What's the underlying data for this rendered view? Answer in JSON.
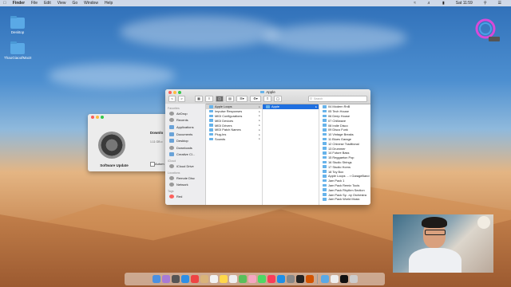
{
  "menubar": {
    "apple": "",
    "items": [
      "Finder",
      "File",
      "Edit",
      "View",
      "Go",
      "Window",
      "Help"
    ],
    "clock": "Sat 11:59"
  },
  "desktop": {
    "icons": [
      {
        "label": "Desktop"
      },
      {
        "label": "ThaoGiaoofMacII"
      }
    ]
  },
  "logo": {
    "text": "LetLogoGo",
    "sub": "GH"
  },
  "software_update": {
    "title": "Software Update",
    "downloading": "Downlo",
    "subline": "1.11 GB o",
    "auto_label": "Autom"
  },
  "finder": {
    "title": "Apple",
    "search_placeholder": "Search",
    "back": "<",
    "forward": ">",
    "sidebar": {
      "favorites_header": "Favorites",
      "favorites": [
        "AirDrop",
        "Recents",
        "Applications",
        "Documents",
        "Desktop",
        "Downloads",
        "Creative Cl..."
      ],
      "icloud_header": "iCloud",
      "icloud": [
        "iCloud Drive"
      ],
      "locations_header": "Locations",
      "locations": [
        "Remote Disc",
        "Network"
      ],
      "tags_header": "Tags",
      "tags": [
        "Red"
      ]
    },
    "col1": [
      "Apple Loops",
      "Impulse Responses",
      "MIDI Configurations",
      "MIDI Devices",
      "MIDI Drivers",
      "MIDI Patch Names",
      "Plug-Ins",
      "Sounds"
    ],
    "col2": [
      "Apple"
    ],
    "col3": [
      "04 Modern RnB",
      "05 Tech House",
      "06 Deep House",
      "07 Chillwave",
      "08 Indie Disco",
      "09 Disco Funk",
      "10 Vintage Breaks",
      "11 Blues Garage",
      "12 Chinese Traditional",
      "13 Drummer",
      "14 Future Bass",
      "15 Reggaeton Pop",
      "16 Studio Strings",
      "17 Studio Horns",
      "18 Toy Box",
      "Apple Loops ... r GarageBand",
      "Jam Pack 1",
      "Jam Pack Remix Tools",
      "Jam Pack Rhythm Section",
      "Jam Pack Sy...ny Orchestra",
      "Jam Pack World Music"
    ]
  },
  "colors": {
    "selection": "#1f6fe0",
    "folder": "#67b3ea",
    "close": "#fc605c",
    "minimize": "#fdbc40",
    "zoom": "#34c84a"
  }
}
